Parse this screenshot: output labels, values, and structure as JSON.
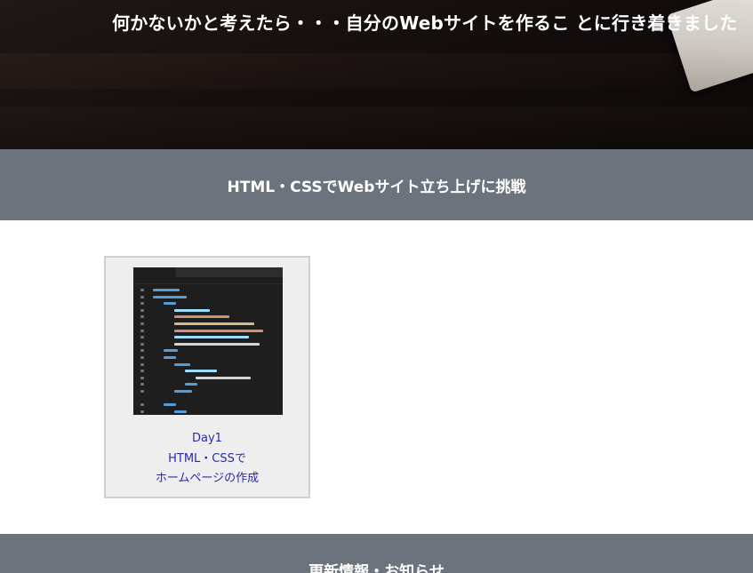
{
  "hero": {
    "title": "何かないかと考えたら・・・自分のWebサイトを作るこ とに行き着きました"
  },
  "section1": {
    "title": "HTML・CSSでWebサイト立ち上げに挑戦"
  },
  "cards": [
    {
      "line1": "Day1",
      "line2": "HTML・CSSで",
      "line3": "ホームページの作成",
      "thumbnail_icon": "code-editor-screenshot"
    }
  ],
  "section2": {
    "title": "更新情報・お知らせ"
  }
}
